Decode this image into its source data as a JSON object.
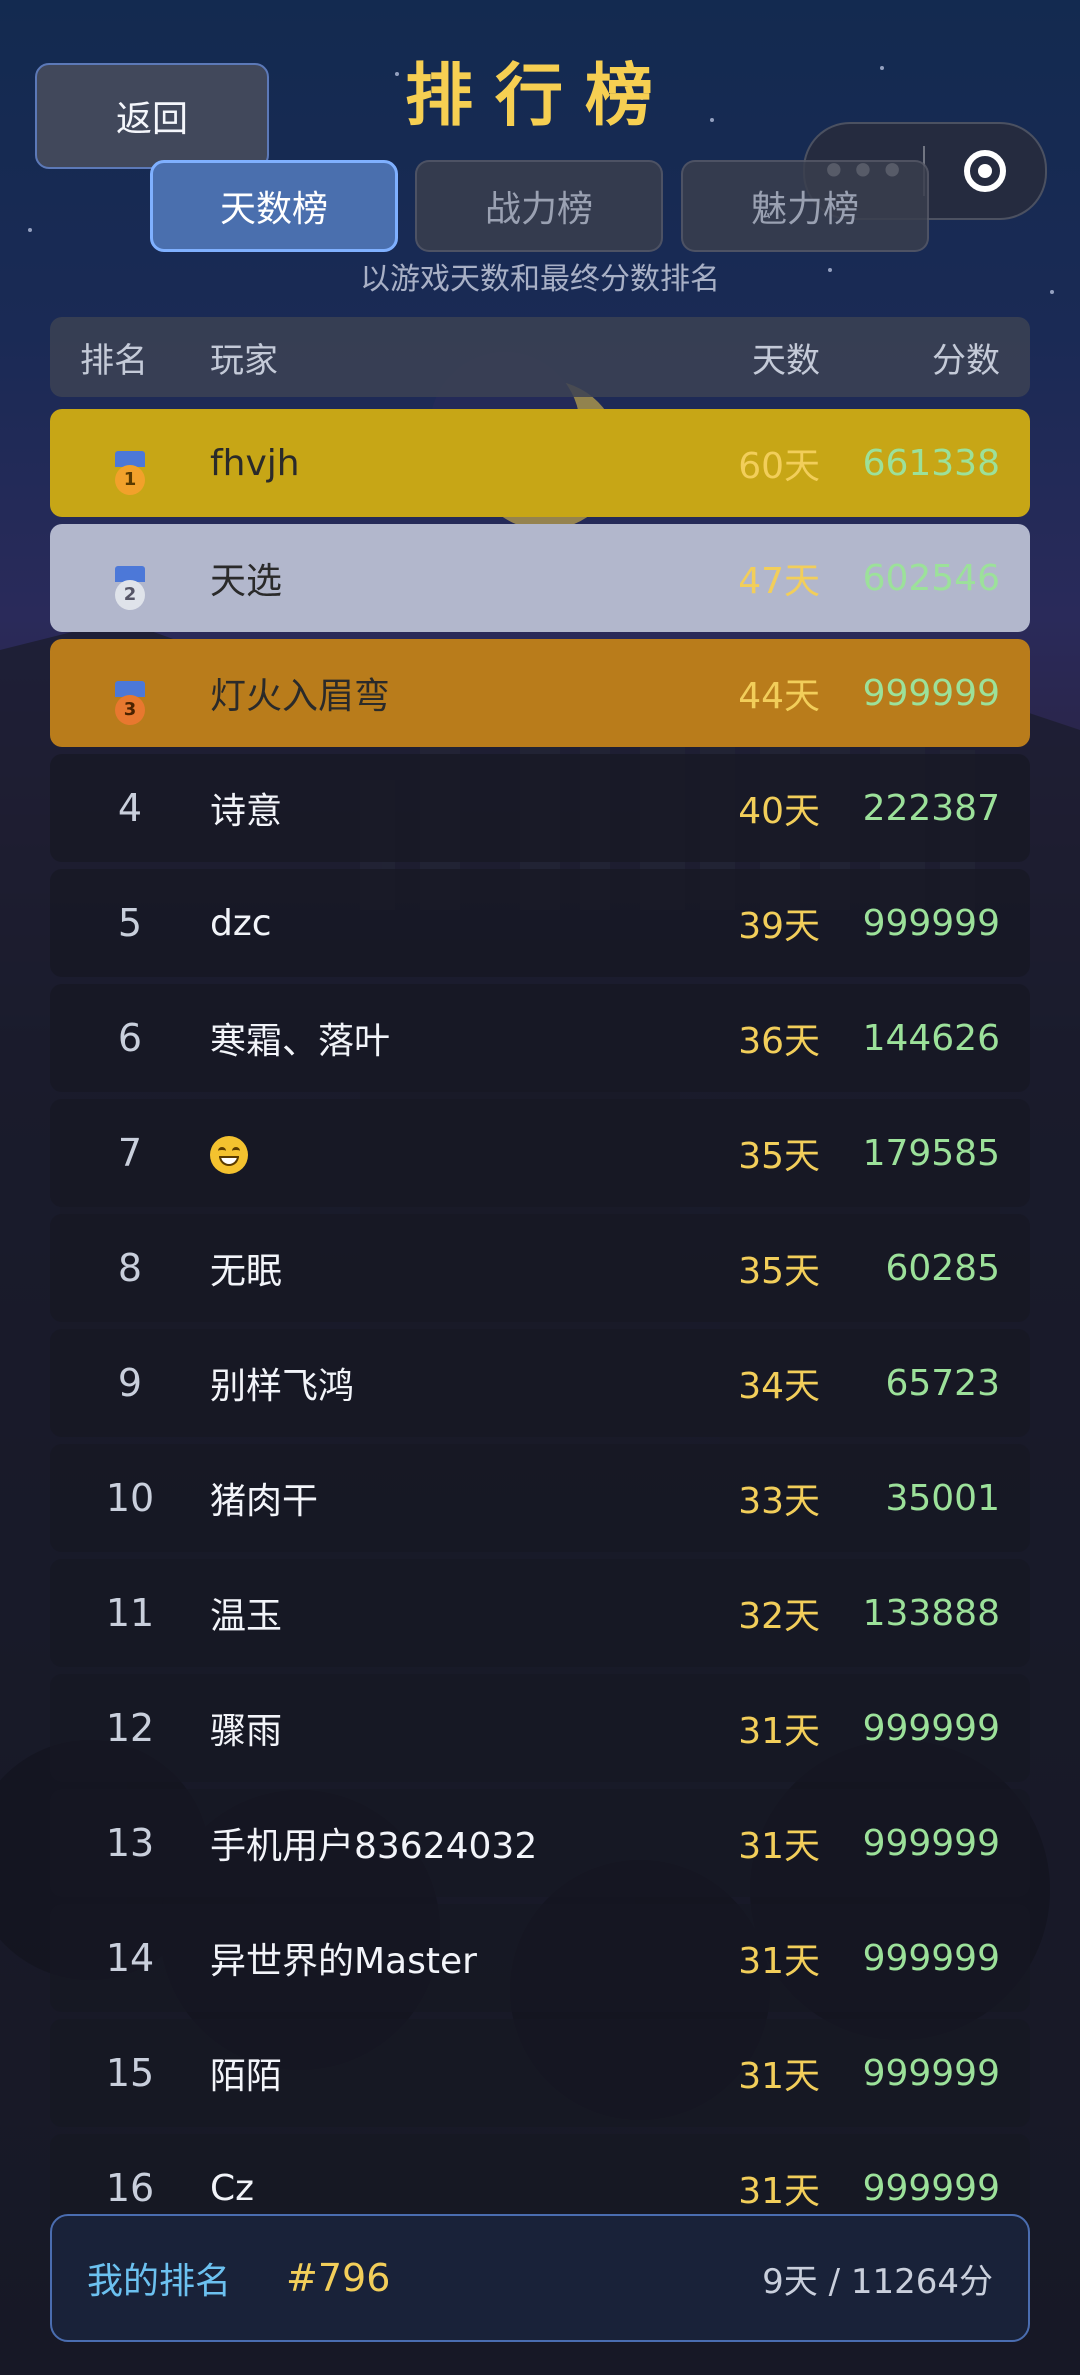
{
  "back_button": "返回",
  "title": "排行榜",
  "capsule": {
    "more_icon": "more-dots-icon",
    "close_icon": "target-circle-icon"
  },
  "tabs": [
    {
      "label": "天数榜",
      "active": true
    },
    {
      "label": "战力榜",
      "active": false
    },
    {
      "label": "魅力榜",
      "active": false
    }
  ],
  "subtitle": "以游戏天数和最终分数排名",
  "table": {
    "headers": {
      "rank": "排名",
      "player": "玩家",
      "days": "天数",
      "score": "分数"
    },
    "rows": [
      {
        "rank": "1",
        "medal": "gold-medal-icon",
        "medal_number": "1",
        "name": "fhvjh",
        "days": "60天",
        "score": "661338"
      },
      {
        "rank": "2",
        "medal": "silver-medal-icon",
        "medal_number": "2",
        "name": "天选",
        "days": "47天",
        "score": "602546"
      },
      {
        "rank": "3",
        "medal": "bronze-medal-icon",
        "medal_number": "3",
        "name": "灯火入眉弯",
        "days": "44天",
        "score": "999999"
      },
      {
        "rank": "4",
        "name": "诗意",
        "days": "40天",
        "score": "222387"
      },
      {
        "rank": "5",
        "name": "dzc",
        "days": "39天",
        "score": "999999"
      },
      {
        "rank": "6",
        "name": "寒霜、落叶",
        "days": "36天",
        "score": "144626"
      },
      {
        "rank": "7",
        "name": "",
        "name_icon": "grinning-face-emoji-icon",
        "days": "35天",
        "score": "179585"
      },
      {
        "rank": "8",
        "name": "无眠",
        "days": "35天",
        "score": "60285"
      },
      {
        "rank": "9",
        "name": "别样飞鸿",
        "days": "34天",
        "score": "65723"
      },
      {
        "rank": "10",
        "name": "猪肉干",
        "days": "33天",
        "score": "35001"
      },
      {
        "rank": "11",
        "name": "温玉",
        "days": "32天",
        "score": "133888"
      },
      {
        "rank": "12",
        "name": "骤雨",
        "days": "31天",
        "score": "999999"
      },
      {
        "rank": "13",
        "name": "手机用户83624032",
        "days": "31天",
        "score": "999999"
      },
      {
        "rank": "14",
        "name": "异世界的Master",
        "days": "31天",
        "score": "999999"
      },
      {
        "rank": "15",
        "name": "陌陌",
        "days": "31天",
        "score": "999999"
      },
      {
        "rank": "16",
        "name": "Cz",
        "days": "31天",
        "score": "999999"
      }
    ]
  },
  "my_rank": {
    "label": "我的排名",
    "rank": "#796",
    "stats": "9天 / 11264分"
  },
  "colors": {
    "title": "#f6cf52",
    "days": "#f2ce5a",
    "score": "#9ce19a",
    "gold_row": "#c7a616",
    "silver_row": "#b2b7cc",
    "bronze_row": "#b97c1b",
    "active_tab": "#4a6fae"
  }
}
